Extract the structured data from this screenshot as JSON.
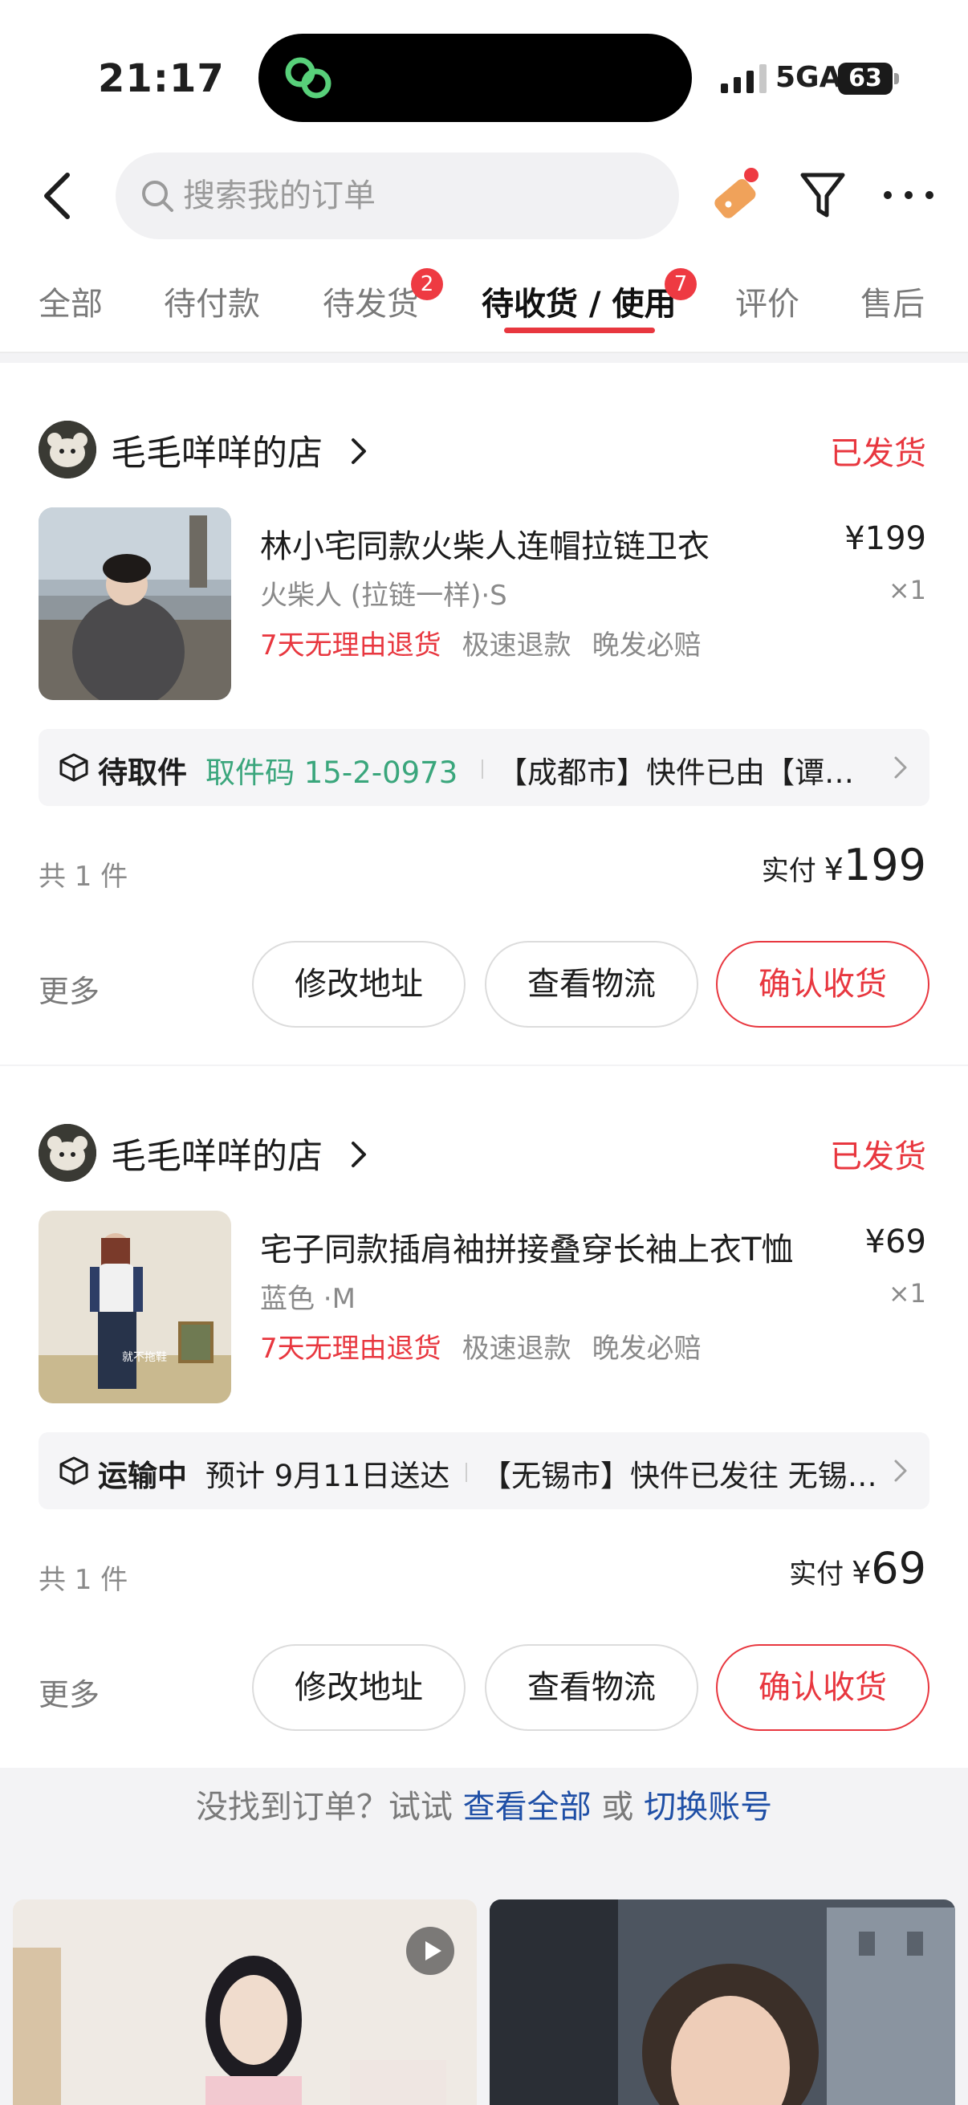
{
  "status_bar": {
    "time": "21:17",
    "network": "5GA",
    "battery": "63"
  },
  "search": {
    "placeholder": "搜索我的订单"
  },
  "tabs": [
    {
      "label": "全部"
    },
    {
      "label": "待付款"
    },
    {
      "label": "待发货",
      "badge": "2"
    },
    {
      "label": "待收货 / 使用",
      "badge": "7",
      "active": true
    },
    {
      "label": "评价"
    },
    {
      "label": "售后"
    }
  ],
  "orders": [
    {
      "shop_name": "毛毛咩咩的店",
      "status": "已发货",
      "product_title": "林小宅同款火柴人连帽拉链卫衣",
      "sku": "火柴人 (拉链一样)·S",
      "price": "¥199",
      "qty": "×1",
      "tags": [
        "7天无理由退货",
        "极速退款",
        "晚发必赔"
      ],
      "logistics_status": "待取件",
      "logistics_code": "取件码 15-2-0973",
      "logistics_msg": "【成都市】快件已由【谭红…",
      "count": "共 1 件",
      "paid_label": "实付",
      "paid_currency": "¥",
      "paid_amount": "199",
      "more": "更多",
      "btn_address": "修改地址",
      "btn_logistics": "查看物流",
      "btn_confirm": "确认收货"
    },
    {
      "shop_name": "毛毛咩咩的店",
      "status": "已发货",
      "product_title": "宅子同款插肩袖拼接叠穿长袖上衣T恤",
      "sku": "蓝色 ·M",
      "price": "¥69",
      "qty": "×1",
      "tags": [
        "7天无理由退货",
        "极速退款",
        "晚发必赔"
      ],
      "logistics_status": "运输中",
      "logistics_eta": "预计 9月11日送达",
      "logistics_msg": "【无锡市】快件已发往 无锡…",
      "thumb_caption": "就不拖鞋",
      "count": "共 1 件",
      "paid_label": "实付",
      "paid_currency": "¥",
      "paid_amount": "69",
      "more": "更多",
      "btn_address": "修改地址",
      "btn_logistics": "查看物流",
      "btn_confirm": "确认收货"
    }
  ],
  "hint": {
    "prefix": "没找到订单？试试",
    "link1": "查看全部",
    "or": "或",
    "link2": "切换账号"
  },
  "colors": {
    "accent": "#e8373f",
    "link": "#1f4fa6",
    "code_green": "#3aa67c"
  }
}
